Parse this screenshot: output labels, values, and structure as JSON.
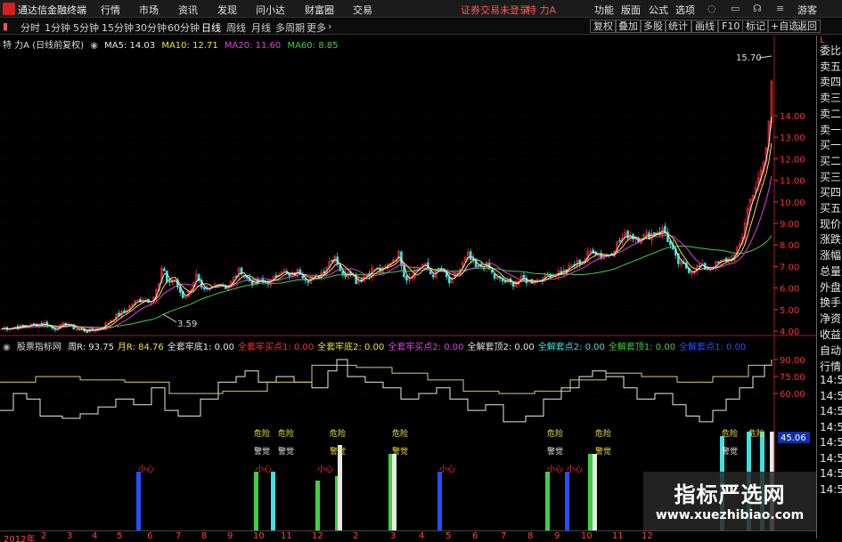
{
  "menubar": {
    "app_title": "通达信金融终端",
    "items": [
      "行情",
      "市场",
      "资讯",
      "发现",
      "问小达",
      "财富圈",
      "交易"
    ],
    "login_status": "证券交易未登录",
    "stock_name": "特 力A",
    "right_items": [
      "功能",
      "版面",
      "公式",
      "选项"
    ],
    "guest": "游客"
  },
  "periodbar": {
    "tabs": [
      "分时",
      "1分钟",
      "5分钟",
      "15分钟",
      "30分钟",
      "60分钟",
      "日线",
      "周线",
      "月线",
      "多周期",
      "更多"
    ],
    "active_tab": "日线",
    "tools": [
      "复权",
      "叠加",
      "多股",
      "统计",
      "画线",
      "F10",
      "标记",
      "+自选",
      "返回"
    ]
  },
  "main_legend": {
    "title": "特 力A (日线前复权)",
    "ma5": "MA5: 14.03",
    "ma10": "MA10: 12.71",
    "ma20": "MA20: 11.60",
    "ma60": "MA60: 8.85"
  },
  "colors": {
    "ma5": "#e8e8e8",
    "ma10": "#f0e040",
    "ma20": "#e040e0",
    "ma60": "#40d040",
    "up": "#ff3030",
    "down": "#40e0e0",
    "axis": "#ff3030"
  },
  "price_axis": {
    "ticks": [
      "14.00",
      "13.00",
      "12.00",
      "11.00",
      "10.00",
      "9.00",
      "8.00",
      "7.00",
      "6.00",
      "5.00",
      "4.00"
    ],
    "high_label": "15.70",
    "low_label": "3.59"
  },
  "sub_legend": {
    "title": "股票指标网",
    "items": [
      {
        "text": "周R: 93.75",
        "color": "#e8e8e8"
      },
      {
        "text": "月R: 84.76",
        "color": "#f0e040"
      },
      {
        "text": "全套牢底1: 0.00",
        "color": "#e8e8e8"
      },
      {
        "text": "全套牢买点1: 0.00",
        "color": "#ff3030"
      },
      {
        "text": "全套牢底2: 0.00",
        "color": "#f0e040"
      },
      {
        "text": "全套牢买点2: 0.00",
        "color": "#e040e0"
      },
      {
        "text": "全解套顶2: 0.00",
        "color": "#e8e8e8"
      },
      {
        "text": "全解套点2: 0.00",
        "color": "#40e0e0"
      },
      {
        "text": "全解套顶1: 0.00",
        "color": "#40d040"
      },
      {
        "text": "全解套点1: 0.00",
        "color": "#3050ff"
      }
    ]
  },
  "sub_axis": {
    "ticks": [
      "90.00",
      "75.00",
      "60.00"
    ],
    "current_value": "45.06"
  },
  "signals": {
    "warn": "危险",
    "alert": "警觉",
    "careful": "小心"
  },
  "side_panel": [
    "委比",
    "卖五",
    "卖四",
    "卖三",
    "卖二",
    "卖一",
    "买一",
    "买二",
    "买三",
    "买四",
    "买五",
    "现价",
    "涨跌",
    "涨幅",
    "总量",
    "外盘",
    "换手",
    "净资",
    "收益"
  ],
  "side_panel_lower": [
    "自动",
    "行情",
    "14:5",
    "14:5",
    "14:5",
    "14:5",
    "14:5",
    "14:5",
    "14:5",
    "14:5"
  ],
  "date_axis": [
    "2012年",
    "2",
    "3",
    "4",
    "5",
    "6",
    "7",
    "8",
    "9",
    "10",
    "11",
    "12",
    "2",
    "3",
    "4",
    "5",
    "6",
    "7",
    "8",
    "9",
    "10",
    "11",
    "12"
  ],
  "watermark": {
    "name": "指标严选网",
    "url": "www.xuezhibiao.com"
  }
}
